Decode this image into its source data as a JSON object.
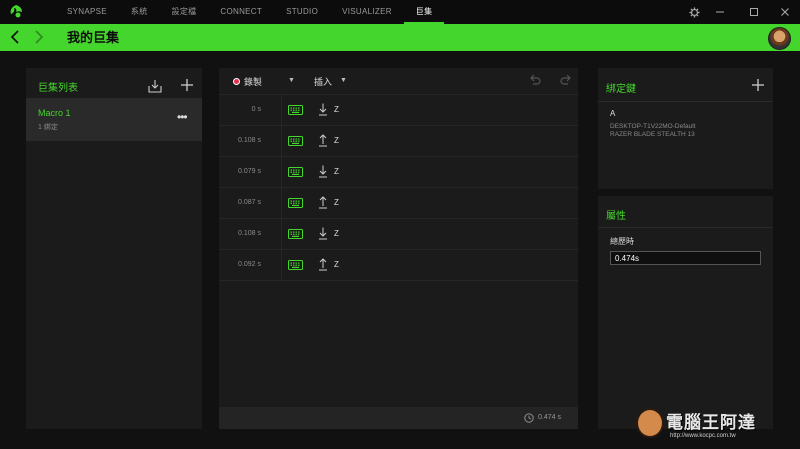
{
  "topbar": {
    "nav": [
      "SYNAPSE",
      "系統",
      "設定檔",
      "CONNECT",
      "STUDIO",
      "VISUALIZER",
      "巨集"
    ],
    "active_index": 6,
    "window_controls": [
      "gear-icon",
      "minimize-icon",
      "maximize-icon",
      "close-icon"
    ]
  },
  "header": {
    "title": "我的巨集"
  },
  "macro_list": {
    "title": "巨集列表",
    "items": [
      {
        "name": "Macro 1",
        "sub": "1 綁定"
      }
    ]
  },
  "editor": {
    "record_label": "錄製",
    "insert_label": "插入",
    "rows": [
      {
        "time": "0 s",
        "direction": "down",
        "key": "Z"
      },
      {
        "time": "0.108 s",
        "direction": "up",
        "key": "Z"
      },
      {
        "time": "0.079 s",
        "direction": "down",
        "key": "Z"
      },
      {
        "time": "0.087 s",
        "direction": "up",
        "key": "Z"
      },
      {
        "time": "0.108 s",
        "direction": "down",
        "key": "Z"
      },
      {
        "time": "0.092 s",
        "direction": "up",
        "key": "Z"
      }
    ],
    "total": "0.474 s"
  },
  "binding": {
    "title": "綁定鍵",
    "key": "A",
    "device_line1": "DESKTOP-T1V22MO-Default",
    "device_line2": "RAZER BLADE STEALTH 13"
  },
  "attributes": {
    "title": "屬性",
    "duration_label": "總歷時",
    "duration_value": "0.474s"
  },
  "watermark": {
    "text": "電腦王阿達",
    "url": "http://www.kocpc.com.tw"
  },
  "colors": {
    "accent": "#44d62c",
    "background": "#111111",
    "panel": "#1b1b1b"
  }
}
